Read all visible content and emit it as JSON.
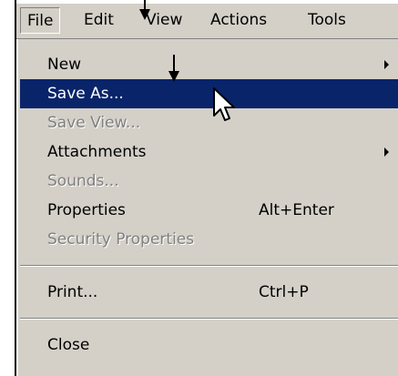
{
  "menubar": {
    "items": [
      {
        "label": "File"
      },
      {
        "label": "Edit"
      },
      {
        "label": "View"
      },
      {
        "label": "Actions"
      },
      {
        "label": "Tools"
      }
    ]
  },
  "file_menu": {
    "items": [
      {
        "label": "New",
        "state": "enabled",
        "submenu": true
      },
      {
        "label": "Save As...",
        "state": "highlighted"
      },
      {
        "label": "Save View...",
        "state": "disabled"
      },
      {
        "label": "Attachments",
        "state": "enabled",
        "submenu": true
      },
      {
        "label": "Sounds...",
        "state": "disabled"
      },
      {
        "label": "Properties",
        "shortcut": "Alt+Enter",
        "state": "enabled"
      },
      {
        "label": "Security Properties",
        "state": "disabled"
      },
      {
        "label": "Print...",
        "shortcut": "Ctrl+P",
        "state": "enabled"
      },
      {
        "label": "Close",
        "state": "enabled"
      }
    ]
  },
  "colors": {
    "menu_background": "#d4d0c8",
    "highlight": "#0a246a",
    "disabled_text": "#808080"
  },
  "icons": [
    "submenu-arrow-icon",
    "mouse-pointer-icon",
    "annotation-arrow-icon"
  ]
}
